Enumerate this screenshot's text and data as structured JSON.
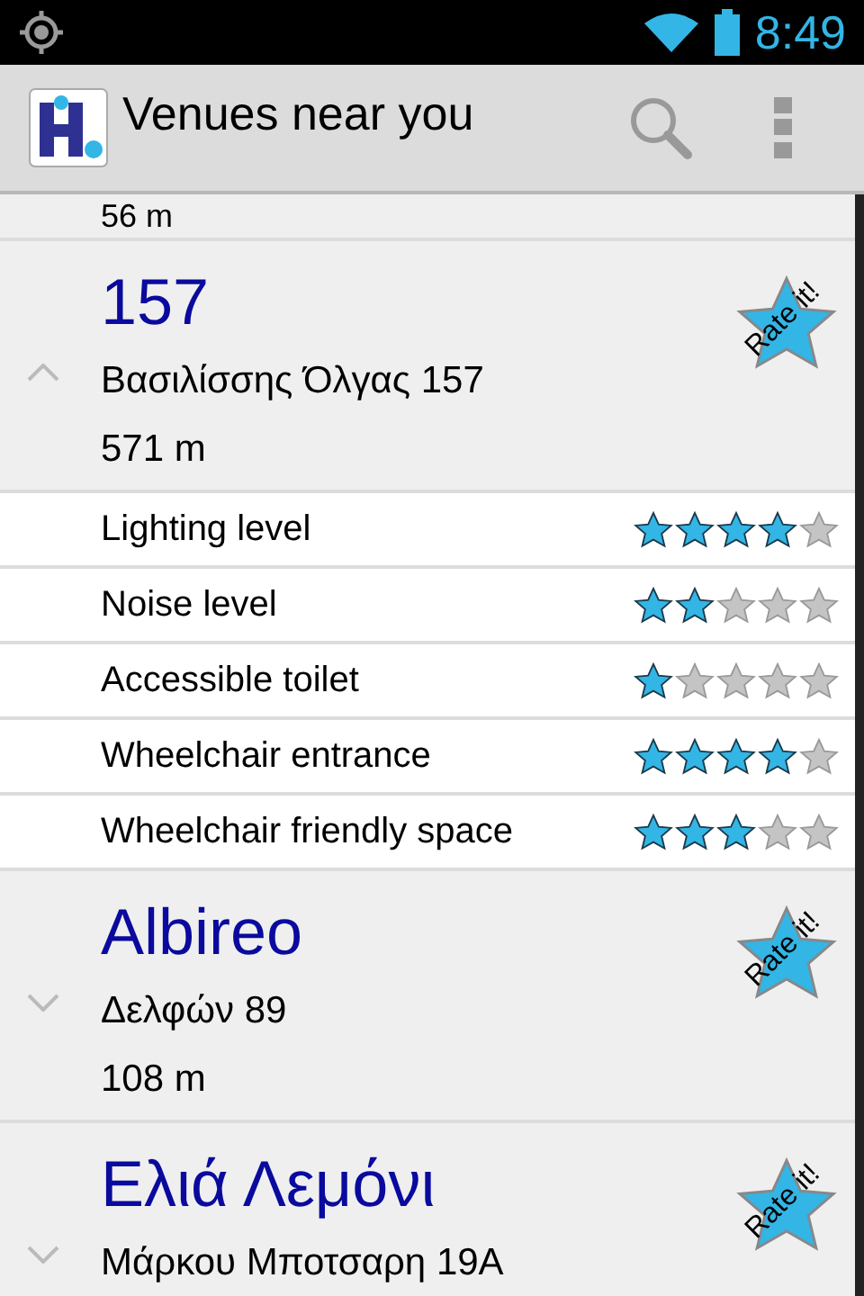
{
  "status_bar": {
    "time": "8:49"
  },
  "action_bar": {
    "title": "Venues near you"
  },
  "previous_venue": {
    "distance": "56 m"
  },
  "venues": [
    {
      "name": "157",
      "address": "Βασιλίσσης Όλγας 157",
      "distance": "571 m",
      "rate_label": "Rate it!",
      "expanded": true,
      "attributes": [
        {
          "label": "Lighting level",
          "stars": 4
        },
        {
          "label": "Noise level",
          "stars": 2
        },
        {
          "label": "Accessible toilet",
          "stars": 1
        },
        {
          "label": "Wheelchair entrance",
          "stars": 4
        },
        {
          "label": "Wheelchair friendly space",
          "stars": 3
        }
      ]
    },
    {
      "name": "Albireo",
      "address": "Δελφών 89",
      "distance": "108 m",
      "rate_label": "Rate it!",
      "expanded": false
    },
    {
      "name": "Ελιά Λεμόνι",
      "address": "Μάρκου Μποτσαρη 19Α",
      "rate_label": "Rate it!",
      "expanded": false
    }
  ]
}
